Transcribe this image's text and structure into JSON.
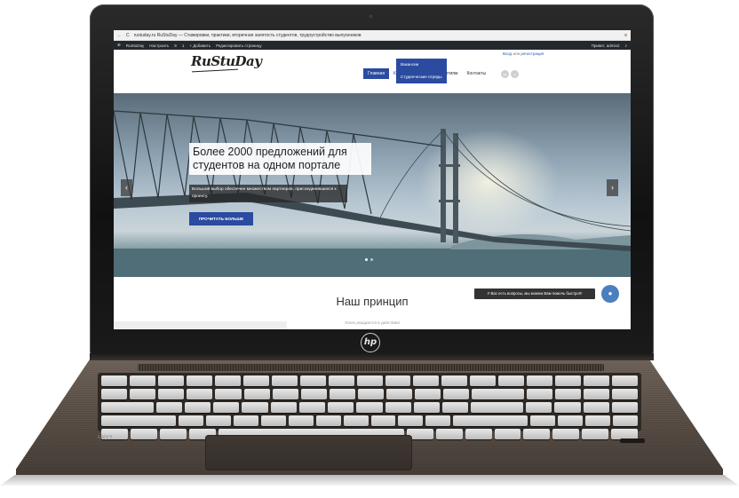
{
  "browser": {
    "back": "←",
    "reload": "C",
    "url_text": "rustuday.ru  RuStuDay — Стажировки, практики, вторичная занятость студентов, трудоустройство выпускников"
  },
  "admin_bar": {
    "site": "RuStuDay",
    "customize": "Настроить",
    "updates": "9",
    "comments": "1",
    "add": "+ Добавить",
    "edit": "Редактировать страницу",
    "greeting": "Привет, admin2"
  },
  "header": {
    "logo": "RuStuDay",
    "login": "Вход",
    "or": "или",
    "register": "регистрация"
  },
  "nav": {
    "items": [
      "Главная",
      "Кандидатам",
      "Предприятиям",
      "Контакты"
    ]
  },
  "dropdown": {
    "items": [
      "Вакансии",
      "Студенческие отряды"
    ]
  },
  "hero": {
    "title": "Более 2000 предложений для студентов на одном портале",
    "subtitle": "Большой выбор обеспечен множеством партнеров, присоединившихся к проекту.",
    "button": "ПРОЧИТАТЬ БОЛЬШЕ",
    "prev": "‹",
    "next": "›"
  },
  "section": {
    "title": "Наш принцип",
    "subtitle": "Успех рождается в действии!"
  },
  "chat": {
    "text": "У Вас есть вопросы, мы можем Вам помочь быстро!!!",
    "icon": "chat-icon"
  },
  "device": {
    "brand_logo": "hp",
    "series": "ENVY"
  }
}
